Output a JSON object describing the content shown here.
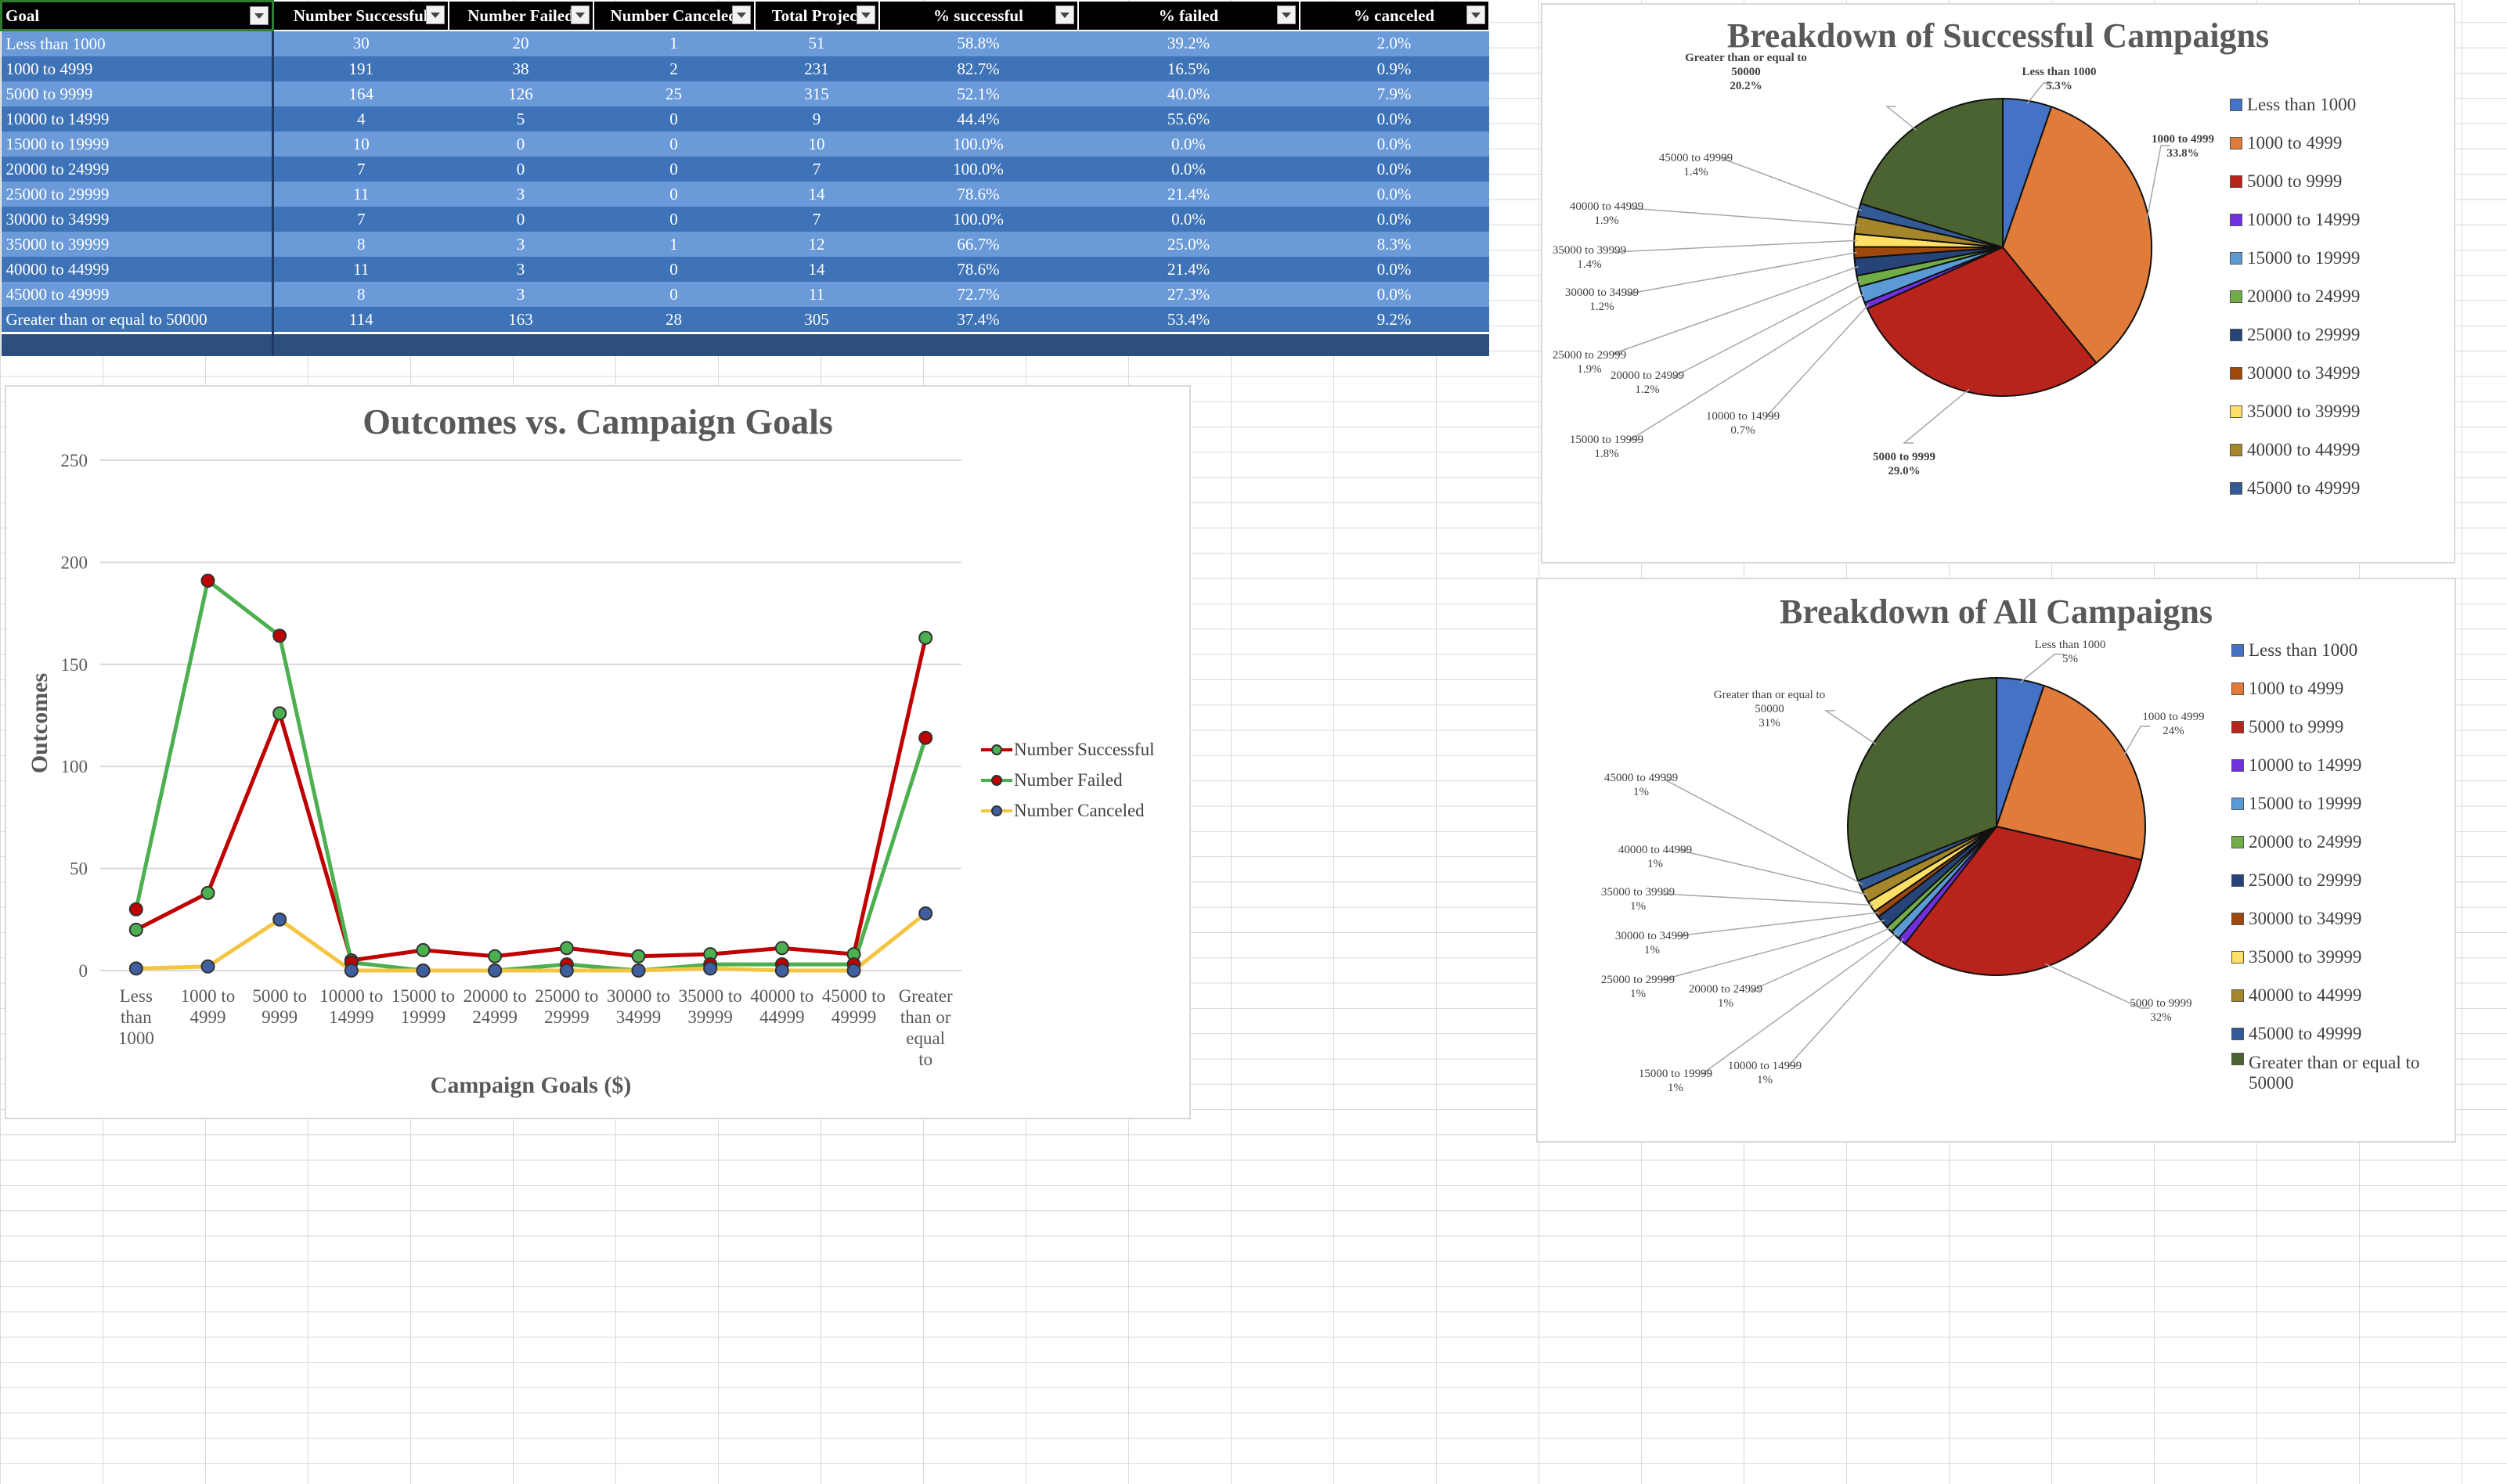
{
  "table": {
    "headers": [
      "Goal",
      "Number Successful",
      "Number Failed",
      "Number Canceled",
      "Total Projects",
      "% successful",
      "% failed",
      "% canceled"
    ],
    "rows": [
      [
        "Less than 1000",
        "30",
        "20",
        "1",
        "51",
        "58.8%",
        "39.2%",
        "2.0%"
      ],
      [
        "1000 to 4999",
        "191",
        "38",
        "2",
        "231",
        "82.7%",
        "16.5%",
        "0.9%"
      ],
      [
        "5000 to 9999",
        "164",
        "126",
        "25",
        "315",
        "52.1%",
        "40.0%",
        "7.9%"
      ],
      [
        "10000 to 14999",
        "4",
        "5",
        "0",
        "9",
        "44.4%",
        "55.6%",
        "0.0%"
      ],
      [
        "15000 to 19999",
        "10",
        "0",
        "0",
        "10",
        "100.0%",
        "0.0%",
        "0.0%"
      ],
      [
        "20000 to 24999",
        "7",
        "0",
        "0",
        "7",
        "100.0%",
        "0.0%",
        "0.0%"
      ],
      [
        "25000 to 29999",
        "11",
        "3",
        "0",
        "14",
        "78.6%",
        "21.4%",
        "0.0%"
      ],
      [
        "30000 to 34999",
        "7",
        "0",
        "0",
        "7",
        "100.0%",
        "0.0%",
        "0.0%"
      ],
      [
        "35000 to 39999",
        "8",
        "3",
        "1",
        "12",
        "66.7%",
        "25.0%",
        "8.3%"
      ],
      [
        "40000 to 44999",
        "11",
        "3",
        "0",
        "14",
        "78.6%",
        "21.4%",
        "0.0%"
      ],
      [
        "45000 to 49999",
        "8",
        "3",
        "0",
        "11",
        "72.7%",
        "27.3%",
        "0.0%"
      ],
      [
        "Greater than or equal to 50000",
        "114",
        "163",
        "28",
        "305",
        "37.4%",
        "53.4%",
        "9.2%"
      ]
    ]
  },
  "chart_data": [
    {
      "type": "line",
      "title": "Outcomes vs. Campaign Goals",
      "xlabel": "Campaign Goals ($)",
      "ylabel": "Outcomes",
      "ylim": [
        0,
        250
      ],
      "yticks": [
        "0",
        "50",
        "100",
        "150",
        "200",
        "250"
      ],
      "categories": [
        "Less than 1000",
        "1000 to 4999",
        "5000 to 9999",
        "10000 to 14999",
        "15000 to 19999",
        "20000 to 24999",
        "25000 to 29999",
        "30000 to 34999",
        "35000 to 39999",
        "40000 to 44999",
        "45000 to 49999",
        "Greater than or equal to 50000"
      ],
      "grid": "horizontal",
      "legend_position": "right",
      "series": [
        {
          "name": "Number Successful",
          "line_color": "#c00000",
          "marker_color": "#4caf50",
          "values": [
            20,
            38,
            126,
            5,
            10,
            7,
            11,
            7,
            8,
            11,
            8,
            163
          ]
        },
        {
          "name": "Number Failed",
          "line_color": "#4caf50",
          "marker_color": "#c00000",
          "values": [
            30,
            191,
            164,
            4,
            0,
            0,
            3,
            0,
            3,
            3,
            3,
            114
          ]
        },
        {
          "name": "Number Canceled",
          "line_color": "#f4c542",
          "marker_color": "#3f5fa0",
          "values": [
            1,
            2,
            25,
            0,
            0,
            0,
            0,
            0,
            1,
            0,
            0,
            28
          ]
        }
      ]
    },
    {
      "type": "pie",
      "title": "Breakdown of Successful Campaigns",
      "legend_position": "right",
      "categories": [
        "Less than 1000",
        "1000 to 4999",
        "5000 to 9999",
        "10000 to 14999",
        "15000 to 19999",
        "20000 to 24999",
        "25000 to 29999",
        "30000 to 34999",
        "35000 to 39999",
        "40000 to 44999",
        "45000 to 49999",
        "Greater than or equal to 50000"
      ],
      "values": [
        5.3,
        33.8,
        29.0,
        0.7,
        1.8,
        1.2,
        1.9,
        1.2,
        1.4,
        1.9,
        1.4,
        20.2
      ],
      "data_labels": [
        "5.3%",
        "33.8%",
        "29.0%",
        "0.7%",
        "1.8%",
        "1.2%",
        "1.9%",
        "1.2%",
        "1.4%",
        "1.9%",
        "1.4%",
        "20.2%"
      ],
      "legend_entries": [
        "Less than 1000",
        "1000 to 4999",
        "5000 to 9999",
        "10000 to 14999",
        "15000 to 19999",
        "20000 to 24999",
        "25000 to 29999",
        "30000 to 34999",
        "35000 to 39999",
        "40000 to 44999",
        "45000 to 49999"
      ],
      "colors": [
        "#4472c4",
        "#e07b39",
        "#b8231b",
        "#7030e0",
        "#5b9bd5",
        "#70ad47",
        "#264478",
        "#9e480e",
        "#ffe066",
        "#a5862a",
        "#335a95",
        "#4a6330"
      ]
    },
    {
      "type": "pie",
      "title": "Breakdown of All Campaigns",
      "legend_position": "right",
      "categories": [
        "Less than 1000",
        "1000 to 4999",
        "5000 to 9999",
        "10000 to 14999",
        "15000 to 19999",
        "20000 to 24999",
        "25000 to 29999",
        "30000 to 34999",
        "35000 to 39999",
        "40000 to 44999",
        "45000 to 49999",
        "Greater than or equal to 50000"
      ],
      "values": [
        51,
        231,
        315,
        9,
        10,
        7,
        14,
        7,
        12,
        14,
        11,
        305
      ],
      "data_labels": [
        "5%",
        "24%",
        "32%",
        "1%",
        "1%",
        "1%",
        "1%",
        "1%",
        "1%",
        "1%",
        "1%",
        "31%"
      ],
      "legend_entries": [
        "Less than 1000",
        "1000 to 4999",
        "5000 to 9999",
        "10000 to 14999",
        "15000 to 19999",
        "20000 to 24999",
        "25000 to 29999",
        "30000 to 34999",
        "35000 to 39999",
        "40000 to 44999",
        "45000 to 49999",
        "Greater than or equal to 50000"
      ],
      "colors": [
        "#4472c4",
        "#e07b39",
        "#b8231b",
        "#7030e0",
        "#5b9bd5",
        "#70ad47",
        "#264478",
        "#9e480e",
        "#ffe066",
        "#a5862a",
        "#335a95",
        "#4a6330"
      ]
    }
  ]
}
